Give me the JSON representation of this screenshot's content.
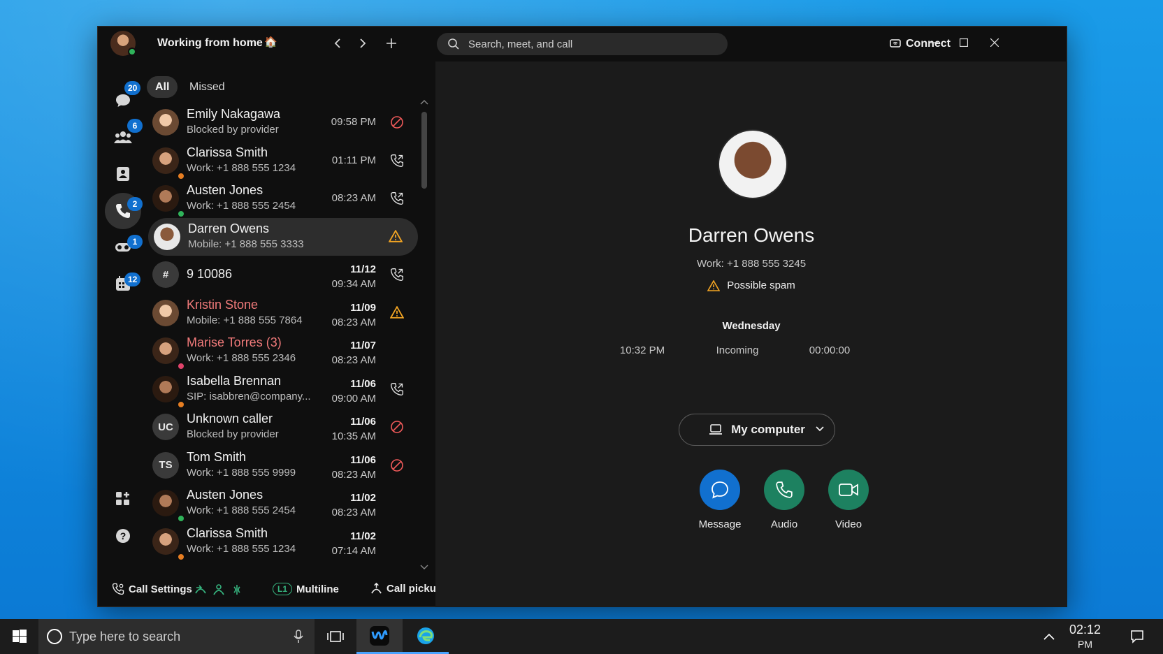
{
  "window": {
    "status_text": "Working from home",
    "status_emoji": "🏠",
    "search_placeholder": "Search, meet, and call",
    "connect_label": "Connect"
  },
  "rail": {
    "messaging_badge": "20",
    "teams_badge": "6",
    "calls_badge": "2",
    "voicemail_badge": "1",
    "meetings_badge": "12"
  },
  "filters": {
    "all": "All",
    "missed": "Missed"
  },
  "calls": [
    {
      "name": "Emily Nakagawa",
      "sub": "Blocked by provider",
      "date": "",
      "time": "09:58 PM",
      "status": "blocked",
      "name_red": false,
      "avatar": "photo1",
      "initials": "",
      "presence": ""
    },
    {
      "name": "Clarissa Smith",
      "sub": "Work: +1 888 555 1234",
      "date": "",
      "time": "01:11 PM",
      "status": "callback",
      "name_red": false,
      "avatar": "photo2",
      "initials": "",
      "presence": "busy"
    },
    {
      "name": "Austen Jones",
      "sub": "Work: +1 888 555 2454",
      "date": "",
      "time": "08:23 AM",
      "status": "callback",
      "name_red": false,
      "avatar": "photo3",
      "initials": "",
      "presence": "available"
    },
    {
      "name": "Darren Owens",
      "sub": "Mobile: +1 888 555 3333",
      "date": "",
      "time": "",
      "status": "spam",
      "name_red": false,
      "avatar": "photo4",
      "initials": "",
      "presence": ""
    },
    {
      "name": "9 10086",
      "sub": "",
      "date": "11/12",
      "time": "09:34 AM",
      "status": "callback",
      "name_red": false,
      "avatar": "initials",
      "initials": "#",
      "presence": ""
    },
    {
      "name": "Kristin Stone",
      "sub": "Mobile: +1 888 555 7864",
      "date": "11/09",
      "time": "08:23 AM",
      "status": "spam",
      "name_red": true,
      "avatar": "photo1",
      "initials": "",
      "presence": ""
    },
    {
      "name": "Marise Torres (3)",
      "sub": "Work: +1 888 555 2346",
      "date": "11/07",
      "time": "08:23 AM",
      "status": "",
      "name_red": true,
      "avatar": "photo2",
      "initials": "",
      "presence": "dnd"
    },
    {
      "name": "Isabella Brennan",
      "sub": "SIP: isabbren@company...",
      "date": "11/06",
      "time": "09:00 AM",
      "status": "callback",
      "name_red": false,
      "avatar": "photo3",
      "initials": "",
      "presence": "busy"
    },
    {
      "name": "Unknown caller",
      "sub": "Blocked by provider",
      "date": "11/06",
      "time": "10:35 AM",
      "status": "blocked",
      "name_red": false,
      "avatar": "initials",
      "initials": "UC",
      "presence": ""
    },
    {
      "name": "Tom Smith",
      "sub": "Work: +1 888 555 9999",
      "date": "11/06",
      "time": "08:23 AM",
      "status": "blocked",
      "name_red": false,
      "avatar": "initials",
      "initials": "TS",
      "presence": ""
    },
    {
      "name": "Austen Jones",
      "sub": "Work: +1 888 555 2454",
      "date": "11/02",
      "time": "08:23 AM",
      "status": "",
      "name_red": false,
      "avatar": "photo3",
      "initials": "",
      "presence": "available"
    },
    {
      "name": "Clarissa Smith",
      "sub": "Work: +1 888 555 1234",
      "date": "11/02",
      "time": "07:14 AM",
      "status": "",
      "name_red": false,
      "avatar": "photo2",
      "initials": "",
      "presence": "busy"
    }
  ],
  "footer": {
    "call_settings": "Call Settings",
    "line_tag": "L1",
    "multiline": "Multiline",
    "call_pickup": "Call pickup"
  },
  "detail": {
    "name": "Darren Owens",
    "phone": "Work: +1 888 555 3245",
    "spam_label": "Possible spam",
    "day": "Wednesday",
    "time": "10:32 PM",
    "direction": "Incoming",
    "duration": "00:00:00",
    "device": "My computer",
    "actions": {
      "message": "Message",
      "audio": "Audio",
      "video": "Video"
    }
  },
  "taskbar": {
    "search_placeholder": "Type here to search",
    "time": "02:12",
    "date": "PM"
  },
  "colors": {
    "accent_blue": "#1170cf",
    "call_green": "#1d8160",
    "message_blue": "#1170cf",
    "warning": "#f5a623",
    "blocked_red": "#f05a5a"
  }
}
